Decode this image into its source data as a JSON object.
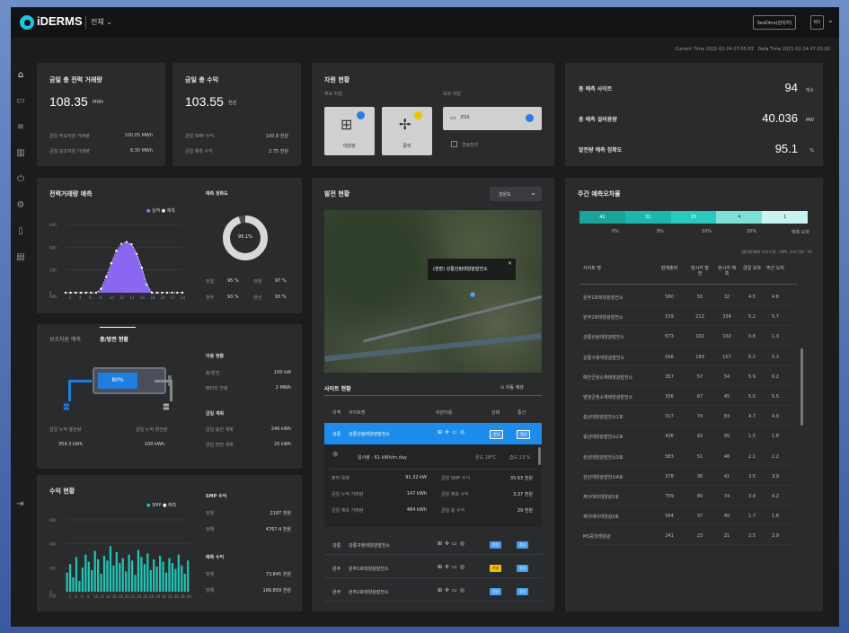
{
  "app": {
    "brand": "iDERMS",
    "scope": "전체",
    "user_btn": "SeoDino(관리자)",
    "lang": "KO"
  },
  "times": {
    "current": "Current Time  2021-02-24 07:05:03",
    "data": "Data Time  2021-02-24 07:01:02"
  },
  "nav_icons": [
    "home-icon",
    "monitor-icon",
    "list-icon",
    "chart-icon",
    "plug-icon",
    "settings-icon",
    "battery-icon",
    "report-icon"
  ],
  "kpi": {
    "trade": {
      "title": "금일 총 전력 거래량",
      "value": "108.35",
      "unit": "MWh",
      "rows": [
        [
          "금일 주요자원 거래량",
          "100.05 MWh"
        ],
        [
          "금일 보조자원 거래량",
          "8.30 MWh"
        ]
      ]
    },
    "revenue": {
      "title": "금일 총 수익",
      "value": "103.55",
      "unit": "천원",
      "rows": [
        [
          "금일 SMP 수익",
          "100.8 천원"
        ],
        [
          "금일 예측 수익",
          "2.75 천원"
        ]
      ]
    }
  },
  "resources": {
    "title": "자원 현황",
    "main_label": "주요 자원",
    "aux_label": "보조 자원",
    "tiles": [
      "태양광",
      "풍력"
    ],
    "ess": "ESS",
    "other": "연료전지"
  },
  "summary": [
    {
      "label": "총 예측 사이트",
      "value": "94",
      "unit": "개소"
    },
    {
      "label": "총 예측 설비용량",
      "value": "40.036",
      "unit": "MW"
    },
    {
      "label": "발전량 예측 정확도",
      "value": "95.1",
      "unit": "%"
    }
  ],
  "forecast": {
    "title": "전력거래량 예측",
    "legend": [
      "실적",
      "예측"
    ],
    "y": [
      "600",
      "400",
      "200",
      "0"
    ],
    "yunit": "kWh",
    "x": [
      "2",
      "4",
      "6",
      "8",
      "10",
      "12",
      "14",
      "16",
      "18",
      "20",
      "22",
      "24"
    ],
    "acc_title": "예측 정확도",
    "acc_value": "95.1%",
    "acc_pct": 95.1,
    "stats": [
      [
        "전일",
        "95 %",
        "전월",
        "97 %"
      ],
      [
        "전주",
        "93 %",
        "전년",
        "93 %"
      ]
    ]
  },
  "chart_data": [
    {
      "type": "area",
      "title": "전력거래량 예측",
      "x": [
        1,
        2,
        3,
        4,
        5,
        6,
        7,
        8,
        9,
        10,
        11,
        12,
        13,
        14,
        15,
        16,
        17,
        18,
        19,
        20,
        21,
        22,
        23,
        24
      ],
      "series": [
        {
          "name": "실적",
          "values": [
            0,
            0,
            0,
            0,
            0,
            0,
            0,
            30,
            130,
            250,
            360,
            420,
            440,
            430,
            350,
            230,
            80,
            0,
            0,
            0,
            0,
            0,
            0,
            0
          ]
        },
        {
          "name": "예측",
          "values": [
            0,
            0,
            0,
            0,
            0,
            0,
            0,
            35,
            140,
            260,
            370,
            430,
            445,
            425,
            340,
            220,
            70,
            0,
            0,
            0,
            0,
            0,
            0,
            0
          ]
        }
      ],
      "ylim": [
        0,
        600
      ]
    },
    {
      "type": "bar",
      "title": "수익 현황",
      "categories": [
        "1",
        "2",
        "3",
        "4",
        "5",
        "6",
        "7",
        "8",
        "9",
        "10",
        "11",
        "12",
        "13",
        "14",
        "15",
        "16",
        "17",
        "18",
        "19",
        "20",
        "21",
        "22",
        "23",
        "24",
        "25",
        "26",
        "27",
        "28",
        "29",
        "30",
        "31",
        "32",
        "33",
        "34",
        "35",
        "36",
        "37",
        "38",
        "39",
        "40"
      ],
      "series": [
        {
          "name": "SMP",
          "values": [
            160,
            230,
            120,
            290,
            90,
            200,
            310,
            250,
            180,
            340,
            270,
            150,
            300,
            260,
            380,
            220,
            330,
            240,
            280,
            170,
            310,
            260,
            140,
            350,
            290,
            230,
            320,
            180,
            270,
            210,
            300,
            250,
            160,
            280,
            240,
            190,
            310,
            220,
            150,
            260
          ]
        }
      ],
      "ylim": [
        0,
        600
      ]
    }
  ],
  "charge": {
    "tabs": [
      "보조자원 예측",
      "충/방전 현황"
    ],
    "battery_pct": "80%",
    "left_label": "금일 누적 충전량",
    "left_value": "354.3 kWh",
    "right_label": "금일 누적 방전량",
    "right_value": "100 kWh",
    "g1": "이용 현황",
    "g1rows": [
      [
        "충/방전",
        "100 kW"
      ],
      [
        "배터리 잔량",
        "2 MWh"
      ]
    ],
    "g2": "금일 계획",
    "g2rows": [
      [
        "금일 충전 계획",
        "240 kWh"
      ],
      [
        "금일 방전 계획",
        "20 kWh"
      ]
    ]
  },
  "revenue_chart": {
    "title": "수익 현황",
    "legend": [
      "SMP",
      "예측"
    ],
    "y": [
      "600",
      "400",
      "200",
      "0"
    ],
    "yunit": "천원",
    "x": [
      "2",
      "4",
      "6",
      "8",
      "10",
      "12",
      "14",
      "16",
      "18",
      "20",
      "22",
      "24",
      "26",
      "28",
      "30",
      "32",
      "34",
      "36",
      "38",
      "40"
    ],
    "smp_title": "SMP 수익",
    "smp_rows": [
      [
        "당월",
        "2187 천원"
      ],
      [
        "당해",
        "4767.4 천원"
      ]
    ],
    "pred_title": "예측 수익",
    "pred_rows": [
      [
        "당월",
        "73,845 천원"
      ],
      [
        "당해",
        "166,859 천원"
      ]
    ]
  },
  "gen": {
    "title": "발전 현황",
    "dropdown": "강원도",
    "tooltip": "(현장) 강릉산림태양광발전소",
    "site_title": "사이트 현황",
    "autosave": "자동 재생",
    "headers": [
      "지역",
      "사이트명",
      "자원이용",
      "상태",
      "통신"
    ],
    "active": {
      "region": "강릉",
      "name": "강릉산림태양광발전소",
      "status": "정상",
      "comm": "정상"
    },
    "detail": {
      "energy": "일사량 : 61 kWh/m.day",
      "temp": "온도  18°C",
      "hum": "습도  23 %",
      "rows": [
        [
          "출력 용량",
          "91.32 kW",
          "금일 SMP 수익",
          "35.63 천원"
        ],
        [
          "금일 누적 거래량",
          "147 kWh",
          "금일 예측 수익",
          "3.37 천원"
        ],
        [
          "금일 예측 거래량",
          "484 kWh",
          "금일 총 수익",
          "29 천원"
        ]
      ]
    },
    "sites": [
      {
        "region": "강릉",
        "name": "강릉구정태양광발전소",
        "status": "정상",
        "comm": "정상"
      },
      {
        "region": "원주",
        "name": "원주1호태양광발전소",
        "status": "이상",
        "comm": "정상"
      },
      {
        "region": "원주",
        "name": "원주2호태양광발전소",
        "status": "정상",
        "comm": "정상"
      }
    ]
  },
  "weekly": {
    "title": "주간 예측오차율",
    "seg": [
      "42",
      "32",
      "15",
      "4",
      "1"
    ],
    "ticks": [
      "0%",
      "8%",
      "10%",
      "20%",
      "예측 오차"
    ],
    "note": "(출력비/예측 오차 단위 : kWh, 오차 단위 : %)",
    "headers": [
      "사이트 명",
      "현재출력",
      "현시각 발전",
      "현시각 예측",
      "금일 오차",
      "주간 오차"
    ],
    "rows": [
      [
        "원주1호태양광발전소",
        "580",
        "55",
        "32",
        "4.5",
        "4.8"
      ],
      [
        "원주2호태양광발전소",
        "539",
        "213",
        "334",
        "5.2",
        "5.7"
      ],
      [
        "강릉산림태양광발전소",
        "673",
        "102",
        "102",
        "0.8",
        "1.3"
      ],
      [
        "강릉구정태양광발전소",
        "568",
        "189",
        "157",
        "6.2",
        "5.3"
      ],
      [
        "예천군청소재태양광발전소",
        "357",
        "57",
        "54",
        "5.9",
        "6.2"
      ],
      [
        "영월군청소재태양광발전소",
        "356",
        "67",
        "45",
        "5.5",
        "5.5"
      ],
      [
        "충남태양광발전소1호",
        "317",
        "74",
        "83",
        "4.7",
        "4.9"
      ],
      [
        "충남태양광발전소2호",
        "436",
        "92",
        "95",
        "1.5",
        "1.8"
      ],
      [
        "삼남태양광발전소3호",
        "583",
        "51",
        "46",
        "2.1",
        "2.2"
      ],
      [
        "삼남태양광발전소4호",
        "378",
        "36",
        "41",
        "3.5",
        "3.9"
      ],
      [
        "제이에이태양광1호",
        "759",
        "80",
        "74",
        "3.9",
        "4.2"
      ],
      [
        "제이에이태양광2호",
        "564",
        "37",
        "45",
        "1.7",
        "1.8"
      ],
      [
        "MS중앙태양광",
        "241",
        "23",
        "21",
        "2.5",
        "2.9"
      ]
    ]
  }
}
